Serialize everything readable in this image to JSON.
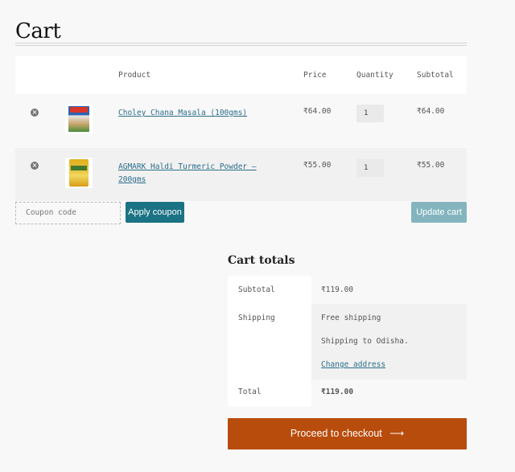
{
  "page": {
    "title": "Cart"
  },
  "cart": {
    "headers": {
      "product": "Product",
      "price": "Price",
      "quantity": "Quantity",
      "subtotal": "Subtotal"
    },
    "remove_symbol": "×",
    "items": [
      {
        "name": "Choley Chana Masala (100gms)",
        "price": "₹64.00",
        "quantity": "1",
        "subtotal": "₹64.00"
      },
      {
        "name_line1": "AGMARK Haldi Turmeric Powder –",
        "name_line2": "200gms",
        "price": "₹55.00",
        "quantity": "1",
        "subtotal": "₹55.00"
      }
    ]
  },
  "actions": {
    "coupon_placeholder": "Coupon code",
    "apply_coupon": "Apply coupon",
    "update_cart": "Update cart"
  },
  "totals": {
    "title": "Cart totals",
    "subtotal_label": "Subtotal",
    "subtotal_value": "₹119.00",
    "shipping_label": "Shipping",
    "shipping_method": "Free shipping",
    "shipping_to": "Shipping to Odisha.",
    "change_address": "Change address",
    "total_label": "Total",
    "total_value": "₹119.00"
  },
  "checkout": {
    "label": "Proceed to checkout",
    "arrow": "⟶"
  },
  "colors": {
    "accent": "#1a7384",
    "accent_disabled": "#84b5bf",
    "checkout": "#b84c0d",
    "link": "#2a6e8a"
  },
  "icons": {
    "remove": "remove-circle-icon",
    "arrow": "arrow-right-icon"
  }
}
